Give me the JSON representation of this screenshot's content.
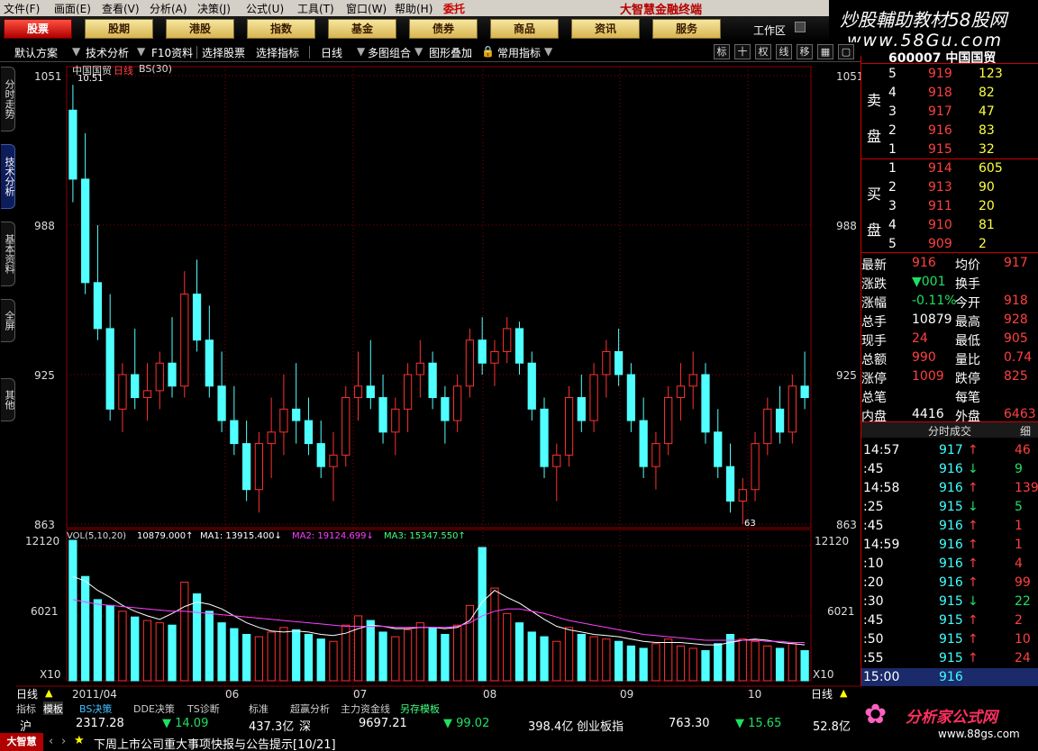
{
  "menu": [
    "文件(F)",
    "画面(E)",
    "查看(V)",
    "分析(A)",
    "决策(J)",
    "公式(U)",
    "工具(T)",
    "窗口(W)",
    "帮助(H)"
  ],
  "menu_tag": "委托",
  "app_title": "大智慧金融终端",
  "banner": {
    "line1": "炒股輔助教材58股网",
    "line2": "www.58Gu.com"
  },
  "tabs": [
    "股票",
    "股期",
    "港股",
    "指数",
    "基金",
    "债券",
    "商品",
    "资讯",
    "服务"
  ],
  "workspace": "工作区",
  "toolbar": {
    "scheme": "默认方案",
    "tech": "技术分析",
    "f10": "F10资料",
    "select_stock": "选择股票",
    "select_index": "选择指标",
    "period": "日线",
    "multi": "多图组合",
    "overlay": "图形叠加",
    "common": "常用指标",
    "icons": [
      "标",
      "十",
      "权",
      "线",
      "移"
    ]
  },
  "left_tabs": [
    "分时走势",
    "技术分析",
    "基本资料",
    "全屏",
    "其他"
  ],
  "chart": {
    "stock": "中国国贸",
    "period": "日线",
    "indicator": "BS(30)",
    "max_label": "10.51",
    "price_ticks": [
      "1051",
      "988",
      "925",
      "863"
    ],
    "min_label": "63",
    "vol_title": "VOL(5,10,20)",
    "vol_value": "10879.000↑",
    "ma1": "MA1: 13915.400↓",
    "ma2": "MA2: 19124.699↓",
    "ma3": "MA3: 15347.550↑",
    "vol_ticks": [
      "12120",
      "6021",
      "X10"
    ],
    "x_labels": [
      "2011/04",
      "06",
      "07",
      "08",
      "09",
      "10"
    ],
    "period_left": "日线",
    "period_right": "日线",
    "colors": {
      "up": "#ff3030",
      "down": "#50ffff",
      "ma1": "#ffffff",
      "ma2": "#ff40ff",
      "ma3": "#40ff80",
      "grid": "#8b0000"
    }
  },
  "chart_data": {
    "type": "candlestick",
    "title": "中国国贸 日线",
    "ylim": [
      860,
      1055
    ],
    "candles": [
      [
        1040,
        1051,
        1000,
        1010
      ],
      [
        1010,
        1030,
        960,
        965
      ],
      [
        965,
        990,
        940,
        945
      ],
      [
        945,
        960,
        905,
        910
      ],
      [
        910,
        930,
        900,
        925
      ],
      [
        925,
        945,
        910,
        915
      ],
      [
        915,
        930,
        905,
        918
      ],
      [
        918,
        935,
        910,
        930
      ],
      [
        930,
        950,
        915,
        920
      ],
      [
        920,
        970,
        915,
        960
      ],
      [
        960,
        975,
        935,
        940
      ],
      [
        940,
        955,
        915,
        920
      ],
      [
        920,
        935,
        900,
        905
      ],
      [
        905,
        920,
        890,
        895
      ],
      [
        895,
        905,
        870,
        875
      ],
      [
        875,
        900,
        865,
        895
      ],
      [
        895,
        915,
        880,
        900
      ],
      [
        900,
        925,
        890,
        910
      ],
      [
        910,
        930,
        895,
        905
      ],
      [
        905,
        915,
        890,
        895
      ],
      [
        895,
        905,
        880,
        885
      ],
      [
        885,
        900,
        870,
        890
      ],
      [
        890,
        920,
        885,
        915
      ],
      [
        915,
        935,
        905,
        920
      ],
      [
        920,
        940,
        910,
        915
      ],
      [
        915,
        925,
        895,
        900
      ],
      [
        900,
        915,
        890,
        910
      ],
      [
        910,
        930,
        900,
        925
      ],
      [
        925,
        940,
        915,
        930
      ],
      [
        930,
        935,
        910,
        915
      ],
      [
        915,
        920,
        895,
        905
      ],
      [
        905,
        925,
        900,
        920
      ],
      [
        920,
        945,
        915,
        940
      ],
      [
        940,
        950,
        925,
        930
      ],
      [
        930,
        940,
        920,
        935
      ],
      [
        935,
        950,
        930,
        945
      ],
      [
        945,
        948,
        925,
        930
      ],
      [
        930,
        935,
        905,
        910
      ],
      [
        910,
        915,
        880,
        885
      ],
      [
        885,
        895,
        870,
        890
      ],
      [
        890,
        920,
        885,
        915
      ],
      [
        915,
        925,
        900,
        905
      ],
      [
        905,
        930,
        900,
        925
      ],
      [
        925,
        940,
        915,
        935
      ],
      [
        935,
        945,
        920,
        925
      ],
      [
        925,
        930,
        900,
        905
      ],
      [
        905,
        915,
        880,
        885
      ],
      [
        885,
        900,
        875,
        895
      ],
      [
        895,
        920,
        890,
        915
      ],
      [
        915,
        930,
        905,
        920
      ],
      [
        920,
        935,
        910,
        925
      ],
      [
        925,
        930,
        895,
        900
      ],
      [
        900,
        910,
        880,
        885
      ],
      [
        885,
        895,
        865,
        870
      ],
      [
        870,
        880,
        860,
        875
      ],
      [
        875,
        900,
        870,
        895
      ],
      [
        895,
        915,
        890,
        910
      ],
      [
        910,
        920,
        895,
        900
      ],
      [
        900,
        925,
        895,
        920
      ],
      [
        920,
        935,
        910,
        915
      ]
    ],
    "volume": [
      12120,
      9000,
      7000,
      6500,
      6000,
      5500,
      5200,
      5000,
      4800,
      8500,
      7500,
      6000,
      5000,
      4500,
      4000,
      3800,
      4200,
      4600,
      4400,
      4000,
      3600,
      3400,
      4800,
      5600,
      5200,
      4200,
      3800,
      4400,
      5000,
      4600,
      4000,
      4800,
      6500,
      11500,
      8000,
      5800,
      5000,
      4200,
      3800,
      3400,
      4600,
      4000,
      3800,
      3600,
      3400,
      3000,
      2800,
      3200,
      3600,
      3000,
      2800,
      2600,
      3200,
      4000,
      3600,
      3400,
      3000,
      2800,
      3200,
      2600
    ],
    "ma1": [
      9000,
      8600,
      7800,
      7200,
      6500,
      6000,
      5600,
      5300,
      5800,
      6400,
      6800,
      6600,
      6200,
      5600,
      5000,
      4600,
      4300,
      4200,
      4300,
      4200,
      4000,
      3900,
      4100,
      4500,
      4800,
      4700,
      4500,
      4500,
      4600,
      4600,
      4500,
      4600,
      5200,
      6800,
      7800,
      7200,
      6700,
      6000,
      5300,
      4700,
      4400,
      4200,
      4000,
      3900,
      3800,
      3600,
      3400,
      3300,
      3300,
      3300,
      3200,
      3100,
      3100,
      3300,
      3500,
      3600,
      3500,
      3300,
      3200,
      3100
    ],
    "ma2": [
      7000,
      6800,
      6600,
      6500,
      6400,
      6300,
      6200,
      6100,
      6000,
      6000,
      5900,
      5800,
      5700,
      5600,
      5500,
      5400,
      5300,
      5200,
      5100,
      5000,
      4900,
      4800,
      4700,
      4700,
      4700,
      4700,
      4600,
      4600,
      4600,
      4600,
      4600,
      4700,
      5000,
      5600,
      6000,
      6200,
      6200,
      6000,
      5800,
      5500,
      5200,
      5000,
      4800,
      4600,
      4400,
      4200,
      4000,
      3900,
      3800,
      3700,
      3600,
      3500,
      3500,
      3500,
      3500,
      3500,
      3400,
      3400,
      3300,
      3300
    ]
  },
  "quote": {
    "code": "600007 中国国贸",
    "sell_label": "卖盘",
    "buy_label": "买盘",
    "sell": [
      [
        "5",
        "919",
        "123"
      ],
      [
        "4",
        "918",
        "82"
      ],
      [
        "3",
        "917",
        "47"
      ],
      [
        "2",
        "916",
        "83"
      ],
      [
        "1",
        "915",
        "32"
      ]
    ],
    "buy": [
      [
        "1",
        "914",
        "605"
      ],
      [
        "2",
        "913",
        "90"
      ],
      [
        "3",
        "911",
        "20"
      ],
      [
        "4",
        "910",
        "81"
      ],
      [
        "5",
        "909",
        "2"
      ]
    ],
    "stats": [
      [
        "最新",
        "916",
        "均价",
        "917"
      ],
      [
        "涨跌",
        "▼001",
        "换手",
        ""
      ],
      [
        "涨幅",
        "-0.11%",
        "今开",
        "918"
      ],
      [
        "总手",
        "10879",
        "最高",
        "928"
      ],
      [
        "现手",
        "24",
        "最低",
        "905"
      ],
      [
        "总额",
        "990",
        "量比",
        "0.74"
      ],
      [
        "涨停",
        "1009",
        "跌停",
        "825"
      ],
      [
        "总笔",
        "",
        "每笔",
        ""
      ],
      [
        "内盘",
        "4416",
        "外盘",
        "6463"
      ]
    ],
    "ticks_title": "分时成交",
    "ticks_detail": "细",
    "ticks": [
      [
        "14:57",
        "917",
        "46",
        "up"
      ],
      [
        ":45",
        "916",
        "9",
        "down"
      ],
      [
        "14:58",
        "916",
        "139",
        "up"
      ],
      [
        ":25",
        "915",
        "5",
        "down"
      ],
      [
        ":45",
        "916",
        "1",
        "up"
      ],
      [
        "14:59",
        "916",
        "1",
        "up"
      ],
      [
        ":10",
        "916",
        "4",
        "up"
      ],
      [
        ":20",
        "916",
        "99",
        "up"
      ],
      [
        ":30",
        "915",
        "22",
        "down"
      ],
      [
        ":45",
        "915",
        "2",
        "up"
      ],
      [
        ":50",
        "915",
        "10",
        "up"
      ],
      [
        ":55",
        "915",
        "24",
        "up"
      ],
      [
        "15:00",
        "916",
        "",
        ""
      ]
    ]
  },
  "bottom_tabs": [
    "指标",
    "模板",
    "BS决策",
    "DDE决策",
    "TS诊断",
    "标准",
    "超赢分析",
    "主力资金线",
    "另存模板"
  ],
  "index_bar": {
    "sh_label": "沪",
    "sh_value": "2317.28",
    "sh_change": "▼ 14.09",
    "sh_amount": "437.3亿",
    "sz_label": "深",
    "sz_value": "9697.21",
    "sz_change": "▼ 99.02",
    "sz_amount": "398.4亿",
    "cy_label": "创业板指",
    "cy_value": "763.30",
    "cy_change": "▼ 15.65",
    "cy_amount": "52.8亿"
  },
  "news": {
    "brand": "大智慧",
    "text": "下周上市公司重大事项快报与公告提示[10/21]"
  },
  "logo2": {
    "line1": "分析家公式网",
    "line2": "www.88gs.com"
  }
}
